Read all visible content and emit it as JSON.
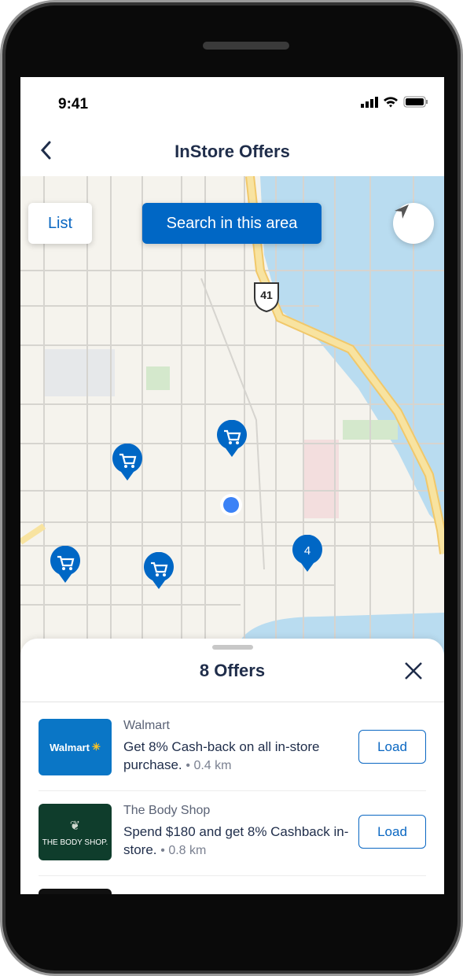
{
  "status": {
    "time": "9:41"
  },
  "header": {
    "title": "InStore Offers"
  },
  "map": {
    "list_label": "List",
    "search_label": "Search in this area",
    "route_shield": "41",
    "cluster_count": "4",
    "colors": {
      "pin": "#0067c5",
      "user": "#3b82f6",
      "water": "#b9dcf0",
      "highway": "#f6dc8c"
    }
  },
  "sheet": {
    "title": "8 Offers",
    "offers": [
      {
        "merchant": "Walmart",
        "logo_text": "Walmart",
        "description": "Get 8% Cash-back on all in-store purchase.",
        "distance": "• 0.4 km",
        "button": "Load"
      },
      {
        "merchant": "The Body Shop",
        "logo_text": "THE BODY SHOP.",
        "description": "Spend $180 and get 8% Cashback in-store.",
        "distance": "• 0.8 km",
        "button": "Load"
      }
    ]
  }
}
